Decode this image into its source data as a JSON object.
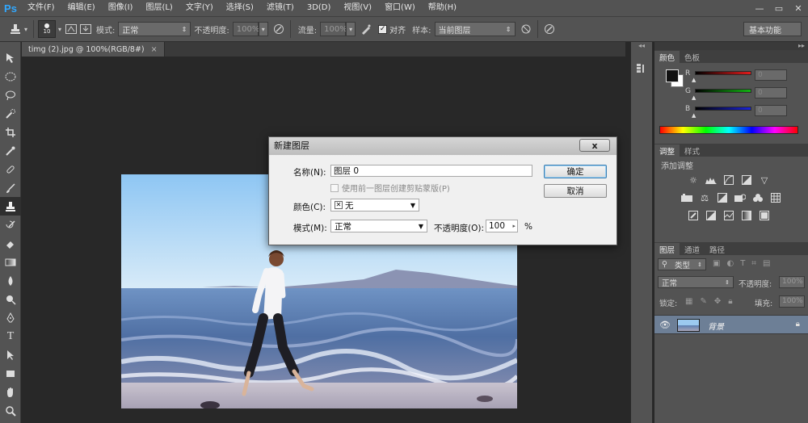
{
  "app": {
    "logo_text": "Ps",
    "menu": [
      "文件(F)",
      "编辑(E)",
      "图像(I)",
      "图层(L)",
      "文字(Y)",
      "选择(S)",
      "滤镜(T)",
      "3D(D)",
      "视图(V)",
      "窗口(W)",
      "帮助(H)"
    ],
    "window_controls": [
      "—",
      "▭",
      "✕"
    ]
  },
  "options_bar": {
    "brush_size": "10",
    "mode_label": "模式:",
    "mode_value": "正常",
    "opacity_label": "不透明度:",
    "opacity_value": "100%",
    "flow_label": "流量:",
    "flow_value": "100%",
    "align_label": "对齐",
    "sample_label": "样本:",
    "sample_value": "当前图层",
    "workspace": "基本功能"
  },
  "document": {
    "tab_title": "timg (2).jpg @ 100%(RGB/8#)",
    "tab_close": "×"
  },
  "color_panel": {
    "tabs": [
      "颜色",
      "色板"
    ],
    "channels": [
      {
        "label": "R",
        "value": "0",
        "color": "#d11b1b"
      },
      {
        "label": "G",
        "value": "0",
        "color": "#12a512"
      },
      {
        "label": "B",
        "value": "0",
        "color": "#1a23c8"
      }
    ]
  },
  "adjustments_panel": {
    "tabs": [
      "调整",
      "样式"
    ],
    "add_label": "添加调整"
  },
  "layers_panel": {
    "tabs": [
      "图层",
      "通道",
      "路径"
    ],
    "filter_label": "类型",
    "blend_mode": "正常",
    "opacity_label": "不透明度:",
    "opacity_value": "100%",
    "lock_label": "锁定:",
    "fill_label": "填充:",
    "fill_value": "100%",
    "layers": [
      {
        "name": "背景",
        "visible": true,
        "locked": true
      }
    ]
  },
  "dialog": {
    "title": "新建图层",
    "close": "x",
    "name_label": "名称(N):",
    "name_value": "图层 0",
    "clip_checkbox_label": "使用前一图层创建剪贴蒙版(P)",
    "color_label": "颜色(C):",
    "color_value": "无",
    "mode_label": "模式(M):",
    "mode_value": "正常",
    "opacity_label": "不透明度(O):",
    "opacity_value": "100",
    "opacity_unit": "%",
    "ok_button": "确定",
    "cancel_button": "取消"
  }
}
